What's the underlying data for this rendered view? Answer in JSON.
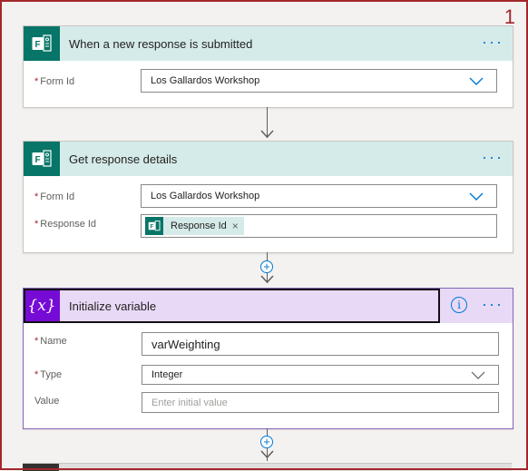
{
  "step_number": "1",
  "trigger": {
    "title": "When a new response is submitted",
    "icon": "microsoft-forms-icon",
    "more_label": "···",
    "fields": [
      {
        "label": "Form Id",
        "required": true,
        "value": "Los Gallardos Workshop"
      }
    ]
  },
  "get_response": {
    "title": "Get response details",
    "icon": "microsoft-forms-icon",
    "more_label": "···",
    "fields": [
      {
        "label": "Form Id",
        "required": true,
        "value": "Los Gallardos Workshop"
      },
      {
        "label": "Response Id",
        "required": true,
        "token": "Response Id",
        "token_close": "×"
      }
    ]
  },
  "init_variable": {
    "title": "Initialize variable",
    "icon_text": "{x}",
    "info_label": "i",
    "more_label": "···",
    "fields": [
      {
        "label": "Name",
        "required": true,
        "value": "varWeighting"
      },
      {
        "label": "Type",
        "required": true,
        "value": "Integer"
      },
      {
        "label": "Value",
        "required": false,
        "placeholder": "Enter initial value"
      }
    ]
  },
  "required_marker": "*",
  "add_step_label": "+",
  "colors": {
    "frame": "#a4262c",
    "forms_brand": "#077568",
    "forms_header": "#d5ebe9",
    "variable_brand": "#770bd6",
    "variable_header": "#e8d9f6",
    "accent": "#0078d4"
  }
}
